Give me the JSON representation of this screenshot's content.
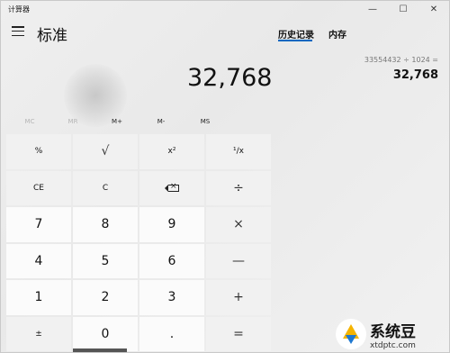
{
  "window": {
    "title": "计算器",
    "controls": [
      "—",
      "☐",
      "✕"
    ]
  },
  "header": {
    "mode_title": "标准",
    "tabs": [
      "历史记录",
      "内存"
    ],
    "active_tab": "历史记录"
  },
  "display": {
    "value": "32,768"
  },
  "history": [
    {
      "expression": "33554432  ÷  1024 =",
      "result": "32,768"
    }
  ],
  "memory_buttons": [
    {
      "label": "MC",
      "enabled": false
    },
    {
      "label": "MR",
      "enabled": false
    },
    {
      "label": "M+",
      "enabled": true
    },
    {
      "label": "M-",
      "enabled": true
    },
    {
      "label": "MS",
      "enabled": true
    }
  ],
  "keypad": {
    "rows": [
      [
        "%",
        "√",
        "x²",
        "¹/x"
      ],
      [
        "CE",
        "C",
        "backspace",
        "÷"
      ],
      [
        "7",
        "8",
        "9",
        "×"
      ],
      [
        "4",
        "5",
        "6",
        "—"
      ],
      [
        "1",
        "2",
        "3",
        "+"
      ],
      [
        "±",
        "0",
        ".",
        "="
      ]
    ]
  },
  "watermark": {
    "main": "系统豆",
    "sub": "xtdptc.com"
  },
  "colors": {
    "accent": "#0067c0",
    "number_key": "#fbfbfb",
    "operator_key": "#f1f1f1"
  }
}
